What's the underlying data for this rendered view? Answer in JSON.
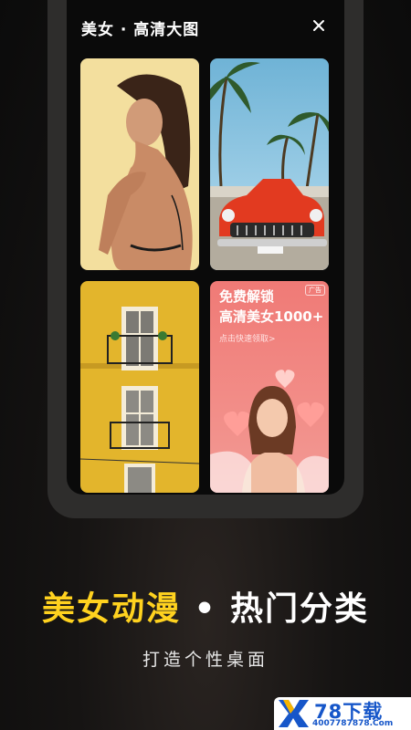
{
  "app": {
    "title": "美女 · 高清大图",
    "close_icon": "close-icon"
  },
  "gallery": {
    "tiles": [
      {
        "name": "portrait-woman-photo"
      },
      {
        "name": "red-vintage-car-palm-trees-photo"
      },
      {
        "name": "yellow-building-windows-photo"
      },
      {
        "name": "promo-banner"
      }
    ]
  },
  "promo": {
    "title": "免费解锁",
    "subtitle": "高清美女1000+",
    "link": "点击快速领取>",
    "badge": "广告"
  },
  "headline": {
    "part_a": "美女动漫",
    "separator": " • ",
    "part_b": "热门分类"
  },
  "tagline": "打造个性桌面",
  "watermark": {
    "name": "78下载",
    "url": "4007787878.Com"
  },
  "colors": {
    "accent_yellow": "#ffd21f",
    "promo_pink": "#f07a76",
    "watermark_blue": "#1656c9"
  }
}
